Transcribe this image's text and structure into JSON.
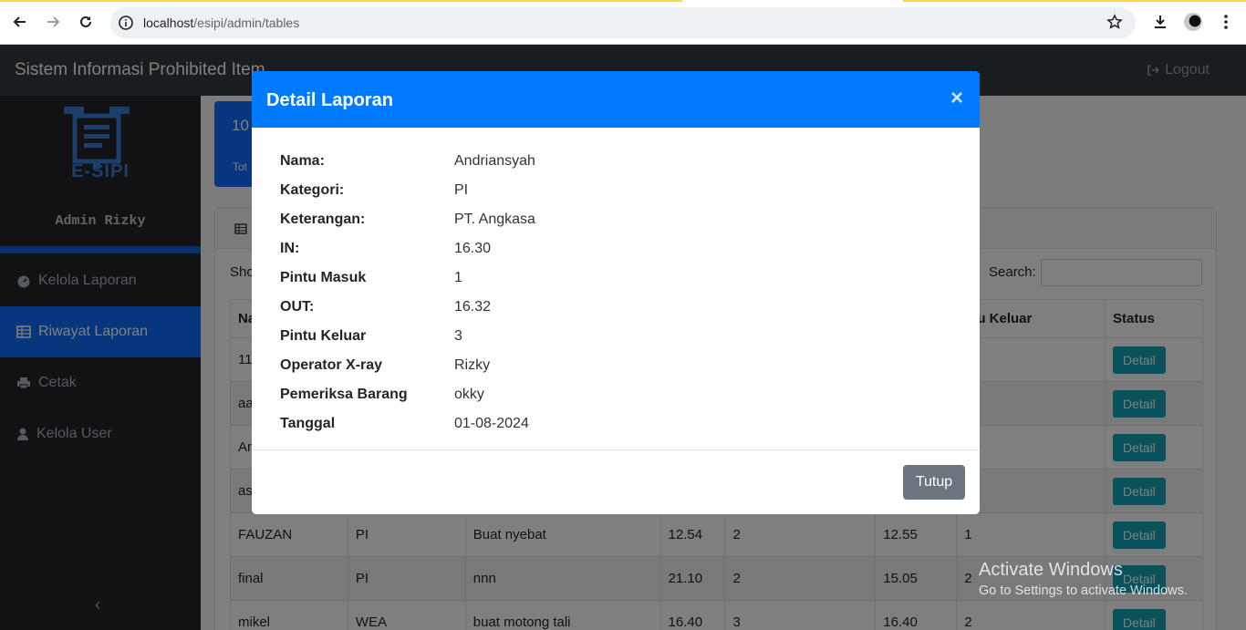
{
  "browser": {
    "url_host": "localhost",
    "url_path": "/esipi/admin/tables"
  },
  "app": {
    "brand": "Sistem Informasi Prohibited Item",
    "logout_label": "Logout",
    "logo_text": "E-SIPI",
    "admin_name": "Admin Rizky",
    "menu": [
      {
        "label": "Kelola Laporan",
        "icon": "dashboard-icon"
      },
      {
        "label": "Riwayat Laporan",
        "icon": "table-icon",
        "active": true
      },
      {
        "label": "Cetak",
        "icon": "print-icon"
      },
      {
        "label": "Kelola User",
        "icon": "user-icon"
      }
    ],
    "stat_number": "10",
    "stat_label": "Tot",
    "show_text": "Sho",
    "search_label": "Search:",
    "table": {
      "headers": [
        "Na",
        "",
        "",
        "",
        "",
        "",
        "ntu Keluar",
        "Status"
      ],
      "rows": [
        [
          "11",
          "",
          "",
          "",
          "",
          "",
          "",
          "Detail"
        ],
        [
          "aa",
          "",
          "",
          "",
          "",
          "",
          "",
          "Detail"
        ],
        [
          "An",
          "",
          "",
          "",
          "",
          "",
          "",
          "Detail"
        ],
        [
          "as",
          "",
          "",
          "",
          "",
          "",
          "",
          "Detail"
        ],
        [
          "FAUZAN",
          "PI",
          "Buat nyebat",
          "12.54",
          "2",
          "12.55",
          "1",
          "Detail"
        ],
        [
          "final",
          "PI",
          "nnn",
          "21.10",
          "2",
          "15.05",
          "2",
          "Detail"
        ],
        [
          "mikel",
          "WEA",
          "buat motong tali",
          "16.40",
          "3",
          "16.40",
          "2",
          "Detail"
        ]
      ]
    }
  },
  "modal": {
    "title": "Detail Laporan",
    "close_glyph": "×",
    "fields": [
      {
        "key": "Nama:",
        "value": "Andriansyah"
      },
      {
        "key": "Kategori:",
        "value": "PI"
      },
      {
        "key": "Keterangan:",
        "value": "PT. Angkasa"
      },
      {
        "key": "IN:",
        "value": "16.30"
      },
      {
        "key": "Pintu Masuk",
        "value": "1"
      },
      {
        "key": "OUT:",
        "value": "16.32"
      },
      {
        "key": "Pintu Keluar",
        "value": "3"
      },
      {
        "key": "Operator X-ray",
        "value": "Rizky"
      },
      {
        "key": "Pemeriksa Barang",
        "value": "okky"
      },
      {
        "key": "Tanggal",
        "value": "01-08-2024"
      }
    ],
    "close_button": "Tutup"
  },
  "watermark": {
    "line1": "Activate Windows",
    "line2": "Go to Settings to activate Windows."
  }
}
